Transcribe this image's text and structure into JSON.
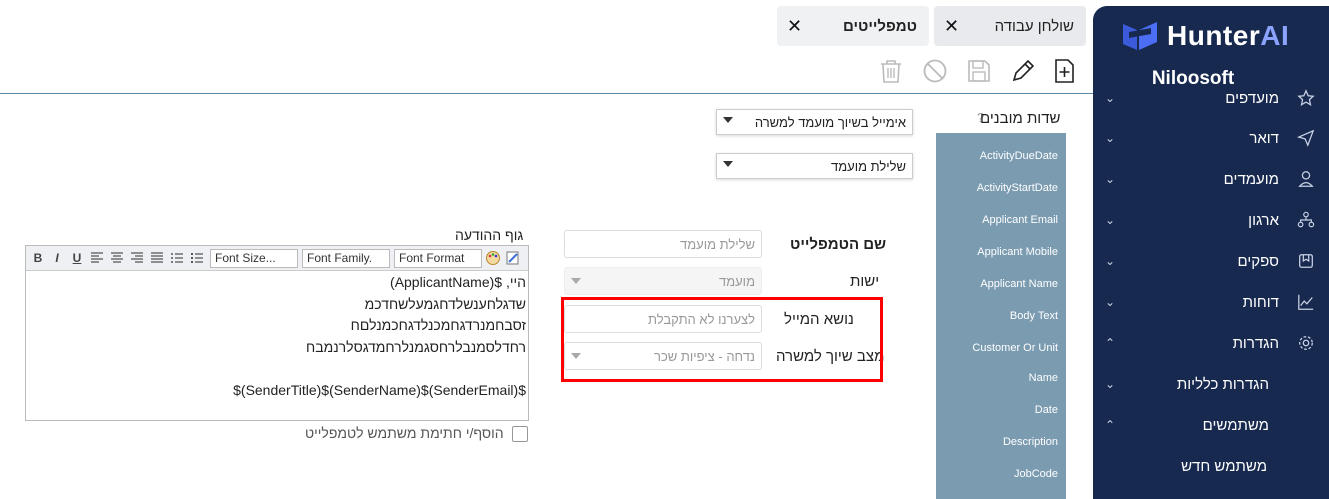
{
  "brand": {
    "name_main": "Hunter",
    "name_accent": "AI",
    "org": "Niloosoft"
  },
  "sidebar": {
    "items": [
      {
        "label": "מועדפים",
        "icon": "star-icon"
      },
      {
        "label": "דואר",
        "icon": "send-icon"
      },
      {
        "label": "מועמדים",
        "icon": "user-icon"
      },
      {
        "label": "ארגון",
        "icon": "org-icon"
      },
      {
        "label": "ספקים",
        "icon": "bookmark-icon"
      },
      {
        "label": "דוחות",
        "icon": "chart-icon"
      },
      {
        "label": "הגדרות",
        "icon": "gear-icon"
      }
    ],
    "sub_items": [
      {
        "label": "הגדרות כלליות"
      },
      {
        "label": "משתמשים"
      },
      {
        "label": "משתמש חדש"
      }
    ]
  },
  "tabs": [
    {
      "label": "שולחן עבודה"
    },
    {
      "label": "טמפלייטים"
    }
  ],
  "fields": {
    "title": "שדות מובנים",
    "help": "?",
    "items": [
      "ActivityDueDate",
      "ActivityStartDate",
      "Applicant Email",
      "Applicant Mobile",
      "Applicant Name",
      "Body Text",
      "Customer Or Unit",
      "Name",
      "Date",
      "Description",
      "JobCode"
    ]
  },
  "selects": {
    "template_type": "אימייל בשיוך מועמד למשרה",
    "template_subtype": "שלילת מועמד"
  },
  "form": {
    "template_name_label": "שם הטמפלייט",
    "template_name_value": "שלילת מועמד",
    "entity_label": "ישות",
    "entity_value": "מועמד",
    "subject_label": "נושא המייל",
    "subject_value": "לצערנו לא התקבלת",
    "status_label": "מצב שיוך למשרה",
    "status_value": "נדחה - ציפיות שכר"
  },
  "editor": {
    "label": "גוף ההודעה",
    "toolbar": {
      "bold": "B",
      "italic": "I",
      "underline": "U",
      "font_size": "Font Size...",
      "font_family": "Font Family.",
      "font_format": "Font Format"
    },
    "lines": [
      "היי, $(ApplicantName)",
      "שדגלחענשלדחגמעלשחדכמ",
      "זסבחמנרדגחמכנלדגחכמנלםח",
      "רחדלסמנבלרחסגמנלרחמדגסלרנמבח",
      "",
      "$(SenderEmail)$(SenderName)$(SenderTitle)$"
    ]
  },
  "signature_checkbox_label": "הוסף/י חתימת משתמש לטמפלייט",
  "colors": {
    "sidebar": "#17294f",
    "fields_panel": "#7b9bb1",
    "highlight": "#ff0000",
    "accent": "#8ba3ff"
  }
}
